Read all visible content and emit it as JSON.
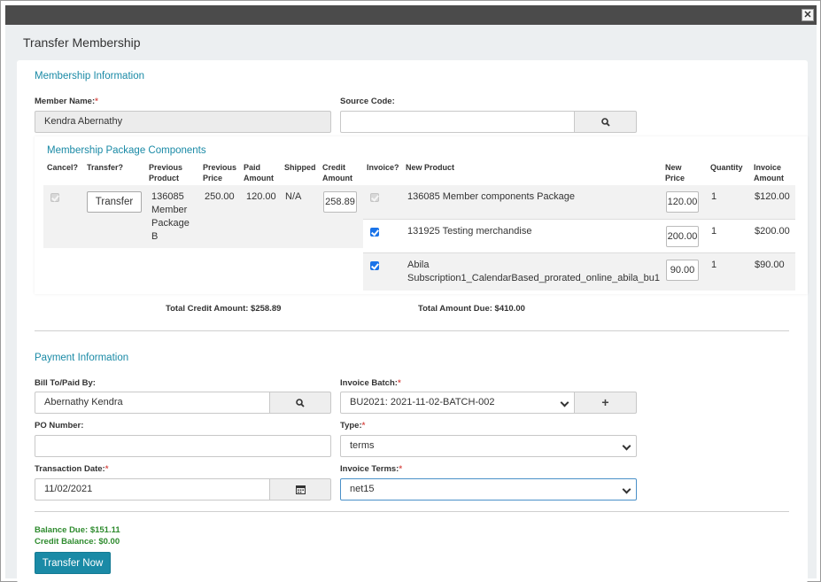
{
  "window": {
    "close_glyph": "✕"
  },
  "dialog": {
    "title": "Transfer Membership"
  },
  "membership": {
    "heading": "Membership Information",
    "member_name_label": "Member Name:",
    "member_name_value": "Kendra Abernathy",
    "source_code_label": "Source Code:",
    "source_code_value": "",
    "search_icon": "search-icon"
  },
  "components": {
    "heading": "Membership Package Components",
    "headers": {
      "cancel": "Cancel?",
      "transfer": "Transfer?",
      "previous_product_1": "Previous",
      "previous_product_2": "Product",
      "previous_price_1": "Previous",
      "previous_price_2": "Price",
      "paid_amount_1": "Paid",
      "paid_amount_2": "Amount",
      "shipped": "Shipped",
      "credit_amount_1": "Credit",
      "credit_amount_2": "Amount",
      "invoice": "Invoice?",
      "new_product": "New Product",
      "new_price_1": "New",
      "new_price_2": "Price",
      "quantity": "Quantity",
      "invoice_amount_1": "Invoice",
      "invoice_amount_2": "Amount"
    },
    "previous": {
      "transfer_button": "Transfer",
      "product_lines": [
        "136085",
        "Member",
        "Package",
        "B"
      ],
      "previous_price": "250.00",
      "paid_amount": "120.00",
      "shipped": "N/A",
      "credit_amount": "258.89",
      "cancel_checked": true
    },
    "new_rows": [
      {
        "product": "136085 Member components Package",
        "product_line2": "",
        "price": "120.00",
        "quantity": "1",
        "invoice_amount": "$120.00",
        "invoice_checked": true,
        "disabled": true
      },
      {
        "product": "131925 Testing merchandise",
        "product_line2": "",
        "price": "200.00",
        "quantity": "1",
        "invoice_amount": "$200.00",
        "invoice_checked": true,
        "disabled": false
      },
      {
        "product": "Abila",
        "product_line2": "Subscription1_CalendarBased_prorated_online_abila_bu1",
        "price": "90.00",
        "quantity": "1",
        "invoice_amount": "$90.00",
        "invoice_checked": true,
        "disabled": false
      }
    ],
    "total_credit": "Total Credit Amount: $258.89",
    "total_due": "Total Amount Due: $410.00"
  },
  "payment": {
    "heading": "Payment Information",
    "bill_to_label": "Bill To/Paid By:",
    "bill_to_value": "Abernathy Kendra",
    "invoice_batch_label": "Invoice Batch:",
    "invoice_batch_value": "BU2021: 2021-11-02-BATCH-002",
    "add_glyph": "+",
    "po_number_label": "PO Number:",
    "po_number_value": "",
    "type_label": "Type:",
    "type_value": "terms",
    "transaction_date_label": "Transaction Date:",
    "transaction_date_value": "11/02/2021",
    "invoice_terms_label": "Invoice Terms:",
    "invoice_terms_value": "net15",
    "required_mark": "*"
  },
  "summary": {
    "balance_due": "Balance Due: $151.11",
    "credit_balance": "Credit Balance: $0.00",
    "transfer_now": "Transfer Now"
  }
}
